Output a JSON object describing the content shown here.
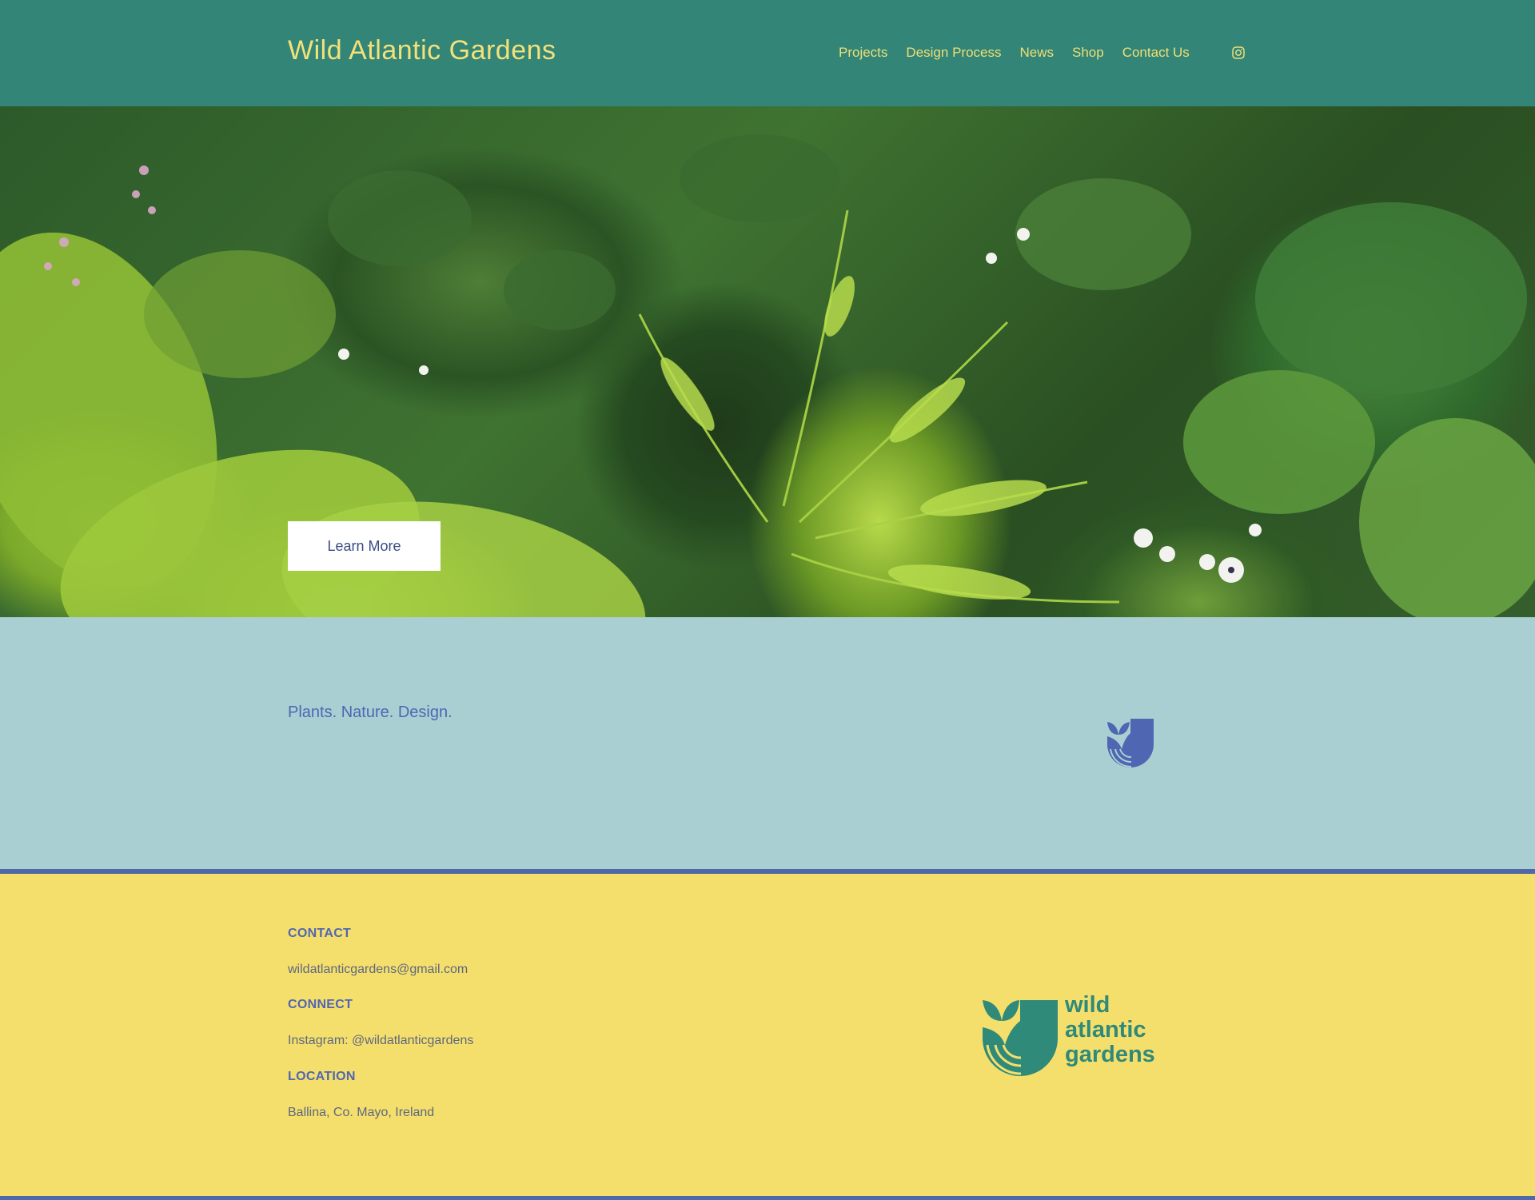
{
  "header": {
    "title": "Wild Atlantic Gardens",
    "nav": [
      "Projects",
      "Design Process",
      "News",
      "Shop",
      "Contact Us"
    ],
    "social_icon": "instagram-icon"
  },
  "hero": {
    "cta_label": "Learn More"
  },
  "band": {
    "tagline": "Plants. Nature. Design.",
    "emblem_icon": "leaf-wave-emblem"
  },
  "footer": {
    "contact_heading": "CONTACT",
    "email": " wildatlanticgardens@gmail.com",
    "connect_heading": "CONNECT",
    "instagram": "Instagram: @wildatlanticgardens",
    "location_heading": "LOCATION",
    "location": "Ballina, Co. Mayo, Ireland",
    "logo_lines": [
      "wild",
      "atlantic",
      "gardens"
    ]
  },
  "colors": {
    "header_bg": "#328577",
    "header_text": "#f3e17a",
    "band_bg": "#aacfd3",
    "accent_blue": "#4f66b3",
    "footer_bg": "#f5df6c",
    "logo_green": "#2f8a7a"
  }
}
